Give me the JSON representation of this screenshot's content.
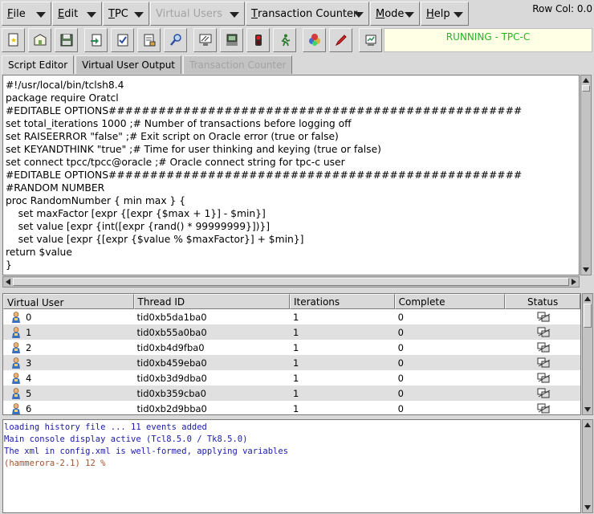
{
  "menubar": {
    "items": [
      {
        "label": "File",
        "underline": "F",
        "rest": "ile",
        "disabled": false
      },
      {
        "label": "Edit",
        "underline": "E",
        "rest": "dit",
        "disabled": false
      },
      {
        "label": "TPC",
        "underline": "T",
        "rest": "PC",
        "disabled": false
      },
      {
        "label": "Virtual Users",
        "underline": "",
        "rest": "Virtual Users",
        "disabled": true
      },
      {
        "label": "Transaction Counter",
        "underline": "T",
        "rest": "ransaction Counter",
        "disabled": false
      },
      {
        "label": "Mode",
        "underline": "M",
        "rest": "ode",
        "disabled": false
      },
      {
        "label": "Help",
        "underline": "H",
        "rest": "elp",
        "disabled": false
      }
    ],
    "row_col": "Row Col:  0.0"
  },
  "toolbar": {
    "buttons": [
      "new-script",
      "open-script",
      "save-script",
      "load-driver",
      "build-schema",
      "edit-options",
      "search",
      "create-users",
      "vu-output",
      "stop",
      "run",
      "colors",
      "edit",
      "transaction-counter"
    ],
    "status": "RUNNING - TPC-C",
    "status_color": "#26b426"
  },
  "tabs": [
    {
      "label": "Script Editor",
      "active": true,
      "disabled": false
    },
    {
      "label": "Virtual User Output",
      "active": false,
      "disabled": false
    },
    {
      "label": "Transaction Counter",
      "active": false,
      "disabled": true
    }
  ],
  "editor": {
    "lines": [
      "#!/usr/local/bin/tclsh8.4",
      "package require Oratcl",
      "#EDITABLE OPTIONS##################################################",
      "set total_iterations 1000 ;# Number of transactions before logging off",
      "set RAISEERROR \"false\" ;# Exit script on Oracle error (true or false)",
      "set KEYANDTHINK \"true\" ;# Time for user thinking and keying (true or false)",
      "set connect tpcc/tpcc@oracle ;# Oracle connect string for tpc-c user",
      "#EDITABLE OPTIONS##################################################",
      "#RANDOM NUMBER",
      "proc RandomNumber { min max } {",
      "    set maxFactor [expr {[expr {$max + 1}] - $min}]",
      "    set value [expr {int([expr {rand() * 99999999}])}]",
      "    set value [expr {[expr {$value % $maxFactor}] + $min}]",
      "return $value",
      "}"
    ]
  },
  "table": {
    "headers": [
      "Virtual User",
      "Thread ID",
      "Iterations",
      "Complete",
      "Status"
    ],
    "rows": [
      {
        "user": "0",
        "thread": "tid0xb5da1ba0",
        "iterations": "1",
        "complete": "0"
      },
      {
        "user": "1",
        "thread": "tid0xb55a0ba0",
        "iterations": "1",
        "complete": "0"
      },
      {
        "user": "2",
        "thread": "tid0xb4d9fba0",
        "iterations": "1",
        "complete": "0"
      },
      {
        "user": "3",
        "thread": "tid0xb459eba0",
        "iterations": "1",
        "complete": "0"
      },
      {
        "user": "4",
        "thread": "tid0xb3d9dba0",
        "iterations": "1",
        "complete": "0"
      },
      {
        "user": "5",
        "thread": "tid0xb359cba0",
        "iterations": "1",
        "complete": "0"
      },
      {
        "user": "6",
        "thread": "tid0xb2d9bba0",
        "iterations": "1",
        "complete": "0"
      }
    ]
  },
  "console": {
    "lines": [
      {
        "text": "loading history file ... 11 events added",
        "kind": "info"
      },
      {
        "text": "Main console display active (Tcl8.5.0 / Tk8.5.0)",
        "kind": "info"
      },
      {
        "text": "The xml in config.xml is well-formed, applying variables",
        "kind": "info"
      },
      {
        "text": "(hammerora-2.1) 12 %",
        "kind": "prompt"
      }
    ]
  }
}
